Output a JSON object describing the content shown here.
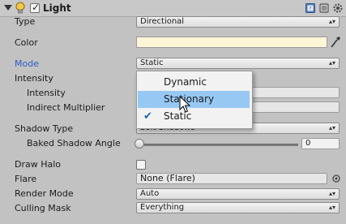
{
  "component": {
    "title": "Light",
    "enabled": true
  },
  "fields": {
    "type": {
      "label": "Type",
      "value": "Directional"
    },
    "color": {
      "label": "Color",
      "value": "#fff6d9"
    },
    "mode": {
      "label": "Mode",
      "value": "Static"
    },
    "intensity_header": {
      "label": "Intensity"
    },
    "intensity": {
      "label": "Intensity"
    },
    "indirect": {
      "label": "Indirect Multiplier"
    },
    "shadow_type": {
      "label": "Shadow Type",
      "value": "Soft Shadows"
    },
    "baked_shadow_angle": {
      "label": "Baked Shadow Angle",
      "value": "0"
    },
    "draw_halo": {
      "label": "Draw Halo",
      "checked": false
    },
    "flare": {
      "label": "Flare",
      "value": "None (Flare)"
    },
    "render_mode": {
      "label": "Render Mode",
      "value": "Auto"
    },
    "culling_mask": {
      "label": "Culling Mask",
      "value": "Everything"
    }
  },
  "mode_menu": {
    "options": [
      "Dynamic",
      "Stationary",
      "Static"
    ],
    "highlighted": "Stationary",
    "checked": "Static"
  }
}
